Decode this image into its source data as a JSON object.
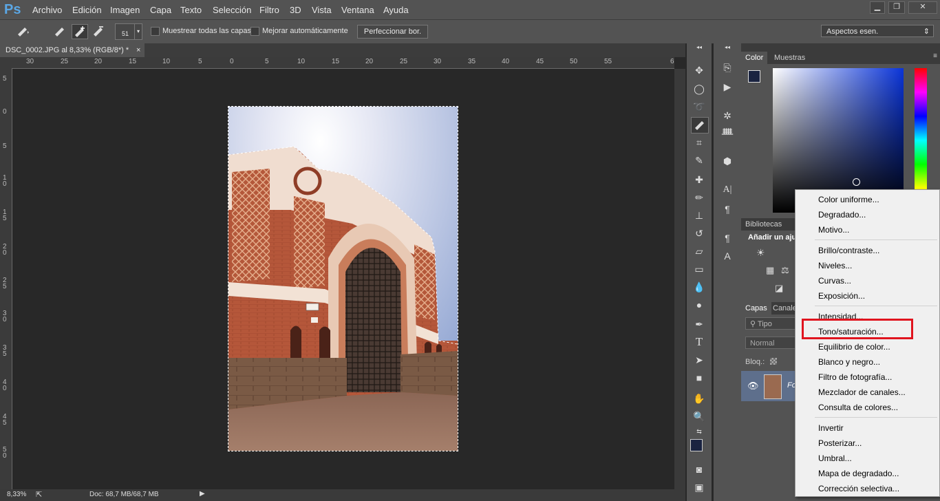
{
  "app": {
    "logo": "Ps"
  },
  "menubar": {
    "items": [
      "Archivo",
      "Edición",
      "Imagen",
      "Capa",
      "Texto",
      "Selección",
      "Filtro",
      "3D",
      "Vista",
      "Ventana",
      "Ayuda"
    ]
  },
  "window_controls": {
    "minimize": "▁",
    "restore": "❐",
    "close": "✕"
  },
  "options_bar": {
    "brush_size": "51",
    "sample_all_layers": "Muestrear todas las capas",
    "auto_enhance": "Mejorar automáticamente",
    "refine_edge_button": "Perfeccionar bor.",
    "workspace_select": "Aspectos esen."
  },
  "document": {
    "tab_title": "DSC_0002.JPG al 8,33% (RGB/8*) *",
    "tab_close": "×",
    "ruler_top_labels": [
      "30",
      "25",
      "20",
      "15",
      "10",
      "5",
      "0",
      "5",
      "10",
      "15",
      "20",
      "25",
      "30",
      "35",
      "40",
      "45",
      "50",
      "55",
      "6"
    ],
    "ruler_left_labels": [
      "5",
      "0",
      "5",
      "1 0",
      "1 5",
      "2 0",
      "2 5",
      "3 0",
      "3 5",
      "4 0",
      "4 5",
      "5 0"
    ]
  },
  "status_bar": {
    "zoom": "8,33%",
    "doc_size": "Doc: 68,7 MB/68,7 MB"
  },
  "panels": {
    "color_tab": "Color",
    "swatches_tab": "Muestras",
    "libraries_tab": "Bibliotecas",
    "adjustments_title": "Añadir un aju",
    "layers_tab": "Capas",
    "channels_tab": "Canale",
    "search_placeholder": "Tipo",
    "blend_mode": "Normal",
    "lock_label": "Bloq.:",
    "layer_name": "Fo",
    "foreground_color": "#1a2340",
    "background_color": "#ffffff"
  },
  "dropdown": {
    "items": [
      "Color uniforme...",
      "Degradado...",
      "Motivo...",
      "Brillo/contraste...",
      "Niveles...",
      "Curvas...",
      "Exposición...",
      "Intensidad...",
      "Tono/saturación...",
      "Equilibrio de color...",
      "Blanco y negro...",
      "Filtro de fotografía...",
      "Mezclador de canales...",
      "Consulta de colores...",
      "Invertir",
      "Posterizar...",
      "Umbral...",
      "Mapa de degradado...",
      "Corrección selectiva..."
    ],
    "highlighted": "Tono/saturación..."
  },
  "accent": {
    "highlight": "#e0141e",
    "ps_blue": "#5ba7e5"
  }
}
